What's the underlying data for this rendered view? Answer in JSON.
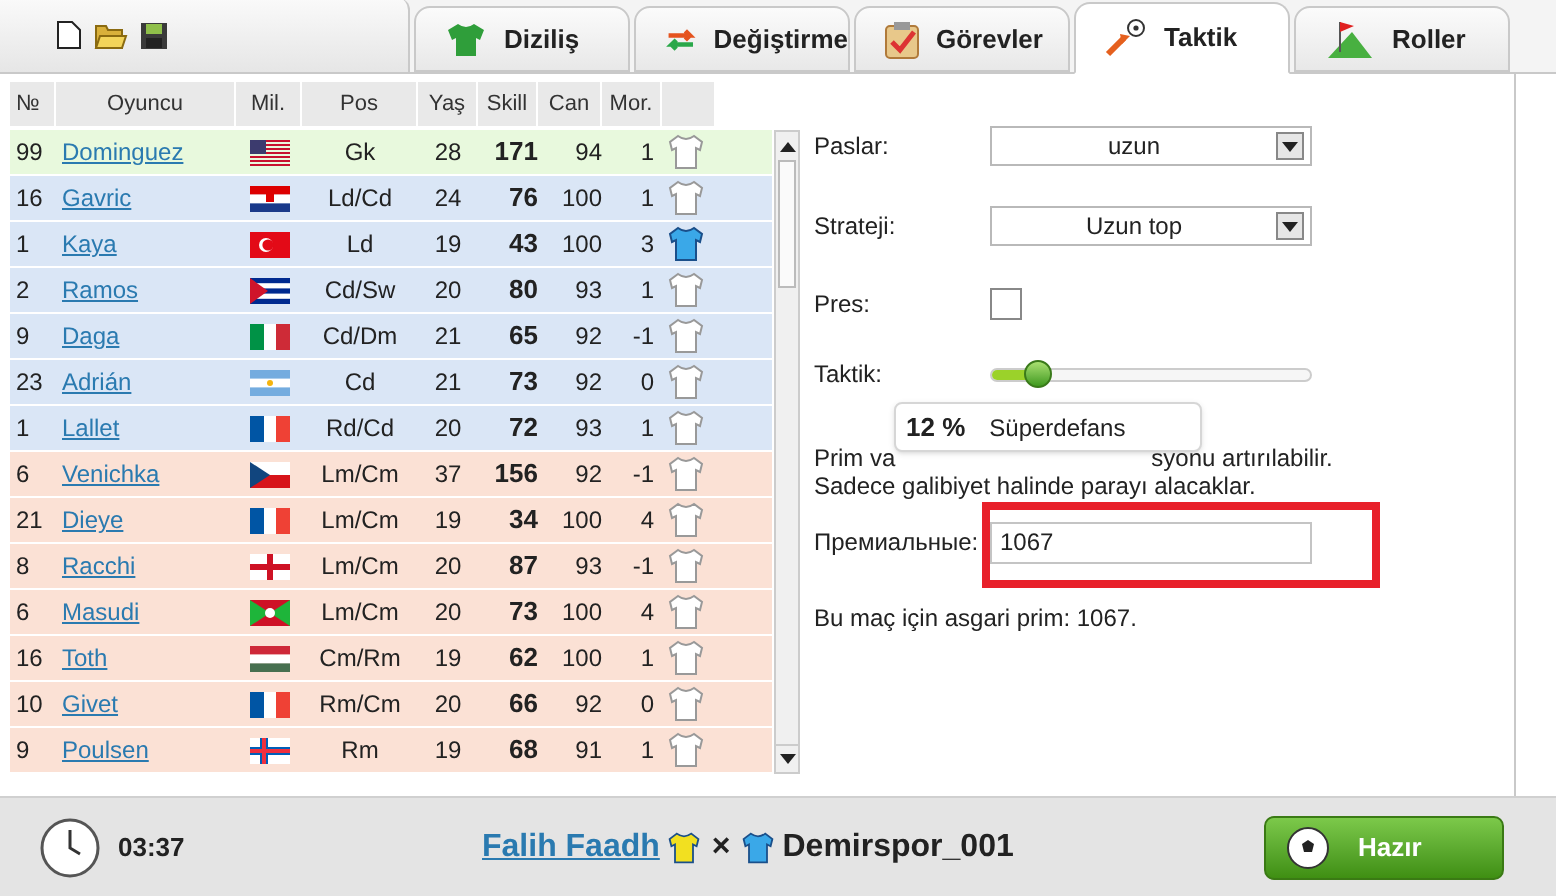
{
  "tabs": [
    {
      "label": "Diziliş",
      "selected": false
    },
    {
      "label": "Değiştirme",
      "selected": false
    },
    {
      "label": "Görevler",
      "selected": false
    },
    {
      "label": "Taktik",
      "selected": true
    },
    {
      "label": "Roller",
      "selected": false
    }
  ],
  "table": {
    "columns": [
      "№",
      "Oyuncu",
      "Mil.",
      "Pos",
      "Yaş",
      "Skill",
      "Can",
      "Mor."
    ],
    "rows": [
      {
        "no": "99",
        "name": "Dominguez",
        "flag": {
          "kind": "us"
        },
        "pos": "Gk",
        "age": "28",
        "skill": "171",
        "can": "94",
        "mor": "1",
        "kind": "goalkeeper",
        "shirt_filled": false
      },
      {
        "no": "16",
        "name": "Gavric",
        "flag": {
          "kind": "hr"
        },
        "pos": "Ld/Cd",
        "age": "24",
        "skill": "76",
        "can": "100",
        "mor": "1",
        "kind": "defender",
        "shirt_filled": false
      },
      {
        "no": "1",
        "name": "Kaya",
        "flag": {
          "kind": "tr"
        },
        "pos": "Ld",
        "age": "19",
        "skill": "43",
        "can": "100",
        "mor": "3",
        "kind": "defender",
        "shirt_filled": true
      },
      {
        "no": "2",
        "name": "Ramos",
        "flag": {
          "kind": "cu"
        },
        "pos": "Cd/Sw",
        "age": "20",
        "skill": "80",
        "can": "93",
        "mor": "1",
        "kind": "defender",
        "shirt_filled": false
      },
      {
        "no": "9",
        "name": "Daga",
        "flag": {
          "kind": "it"
        },
        "pos": "Cd/Dm",
        "age": "21",
        "skill": "65",
        "can": "92",
        "mor": "-1",
        "kind": "defender",
        "shirt_filled": false
      },
      {
        "no": "23",
        "name": "Adrián",
        "flag": {
          "kind": "ar"
        },
        "pos": "Cd",
        "age": "21",
        "skill": "73",
        "can": "92",
        "mor": "0",
        "kind": "defender",
        "shirt_filled": false
      },
      {
        "no": "1",
        "name": "Lallet",
        "flag": {
          "kind": "fr"
        },
        "pos": "Rd/Cd",
        "age": "20",
        "skill": "72",
        "can": "93",
        "mor": "1",
        "kind": "defender",
        "shirt_filled": false
      },
      {
        "no": "6",
        "name": "Venichka",
        "flag": {
          "kind": "cz"
        },
        "pos": "Lm/Cm",
        "age": "37",
        "skill": "156",
        "can": "92",
        "mor": "-1",
        "kind": "midfielder",
        "shirt_filled": false
      },
      {
        "no": "21",
        "name": "Dieye",
        "flag": {
          "kind": "fr"
        },
        "pos": "Lm/Cm",
        "age": "19",
        "skill": "34",
        "can": "100",
        "mor": "4",
        "kind": "midfielder",
        "shirt_filled": false
      },
      {
        "no": "8",
        "name": "Racchi",
        "flag": {
          "kind": "en"
        },
        "pos": "Lm/Cm",
        "age": "20",
        "skill": "87",
        "can": "93",
        "mor": "-1",
        "kind": "midfielder",
        "shirt_filled": false
      },
      {
        "no": "6",
        "name": "Masudi",
        "flag": {
          "kind": "bi"
        },
        "pos": "Lm/Cm",
        "age": "20",
        "skill": "73",
        "can": "100",
        "mor": "4",
        "kind": "midfielder",
        "shirt_filled": false
      },
      {
        "no": "16",
        "name": "Toth",
        "flag": {
          "kind": "hu"
        },
        "pos": "Cm/Rm",
        "age": "19",
        "skill": "62",
        "can": "100",
        "mor": "1",
        "kind": "midfielder",
        "shirt_filled": false
      },
      {
        "no": "10",
        "name": "Givet",
        "flag": {
          "kind": "fr"
        },
        "pos": "Rm/Cm",
        "age": "20",
        "skill": "66",
        "can": "92",
        "mor": "0",
        "kind": "midfielder",
        "shirt_filled": false
      },
      {
        "no": "9",
        "name": "Poulsen",
        "flag": {
          "kind": "fo"
        },
        "pos": "Rm",
        "age": "19",
        "skill": "68",
        "can": "91",
        "mor": "1",
        "kind": "midfielder",
        "shirt_filled": false
      }
    ]
  },
  "tactics": {
    "passes": {
      "label": "Paslar:",
      "value": "uzun"
    },
    "strategy": {
      "label": "Strateji:",
      "value": "Uzun top"
    },
    "press": {
      "label": "Pres:",
      "checked": false
    },
    "tactic": {
      "label": "Taktik:",
      "level": 0.12,
      "percent": "12 %",
      "name": "Süperdefans"
    },
    "info_visible_start": "Prim va",
    "info_visible_end": "syonu artırılabilir.",
    "info_line2": "Sadece galibiyet halinde parayı alacaklar.",
    "bonus": {
      "label": "Премиальные:",
      "value": "1067"
    },
    "minimum": "Bu maç için asgari prim: 1067."
  },
  "footer": {
    "time": "03:37",
    "home": "Falih Faadh",
    "separator": "×",
    "away": "Demirspor_001",
    "ready": "Hazır"
  }
}
